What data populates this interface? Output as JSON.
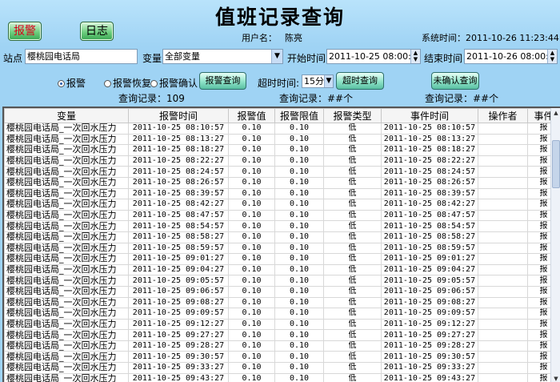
{
  "app": {
    "title": "值班记录查询",
    "user_label": "用户名：",
    "user_name": "陈亮",
    "system_time_label": "系统时间：",
    "system_time": "2011-10-26 11:23:44"
  },
  "nav": {
    "alarm_button": "报警",
    "log_button": "日志"
  },
  "filters": {
    "station_label": "站点",
    "station_value": "樱桃园电话局",
    "variable_label": "变量",
    "variable_value": "全部变量",
    "start_label": "开始时间",
    "start_value": "2011-10-25 08:00:00",
    "end_label": "结束时间",
    "end_value": "2011-10-26 08:00:00"
  },
  "query": {
    "radio_alarm": "报警",
    "radio_recover": "报警恢复",
    "radio_confirm": "报警确认",
    "alarm_query_button": "报警查询",
    "timeout_label": "超时时间:",
    "timeout_value": "15分",
    "timeout_query_button": "超时查询",
    "unconfirmed_query_button": "未确认查询",
    "record_label_1": "查询记录：109",
    "record_label_2": "查询记录：##个",
    "record_label_3": "查询记录：##个"
  },
  "table": {
    "columns": [
      "变量",
      "报警时间",
      "报警值",
      "报警限值",
      "报警类型",
      "事件时间",
      "操作者",
      "事件"
    ],
    "rows": [
      [
        "樱桃园电话局_一次回水压力",
        "2011-10-25 08:10:57",
        "0.10",
        "0.10",
        "低",
        "2011-10-25 08:10:57",
        "",
        "报"
      ],
      [
        "樱桃园电话局_一次回水压力",
        "2011-10-25 08:13:27",
        "0.10",
        "0.10",
        "低",
        "2011-10-25 08:13:27",
        "",
        "报"
      ],
      [
        "樱桃园电话局_一次回水压力",
        "2011-10-25 08:18:27",
        "0.10",
        "0.10",
        "低",
        "2011-10-25 08:18:27",
        "",
        "报"
      ],
      [
        "樱桃园电话局_一次回水压力",
        "2011-10-25 08:22:27",
        "0.10",
        "0.10",
        "低",
        "2011-10-25 08:22:27",
        "",
        "报"
      ],
      [
        "樱桃园电话局_一次回水压力",
        "2011-10-25 08:24:57",
        "0.10",
        "0.10",
        "低",
        "2011-10-25 08:24:57",
        "",
        "报"
      ],
      [
        "樱桃园电话局_一次回水压力",
        "2011-10-25 08:26:57",
        "0.10",
        "0.10",
        "低",
        "2011-10-25 08:26:57",
        "",
        "报"
      ],
      [
        "樱桃园电话局_一次回水压力",
        "2011-10-25 08:39:57",
        "0.10",
        "0.10",
        "低",
        "2011-10-25 08:39:57",
        "",
        "报"
      ],
      [
        "樱桃园电话局_一次回水压力",
        "2011-10-25 08:42:27",
        "0.10",
        "0.10",
        "低",
        "2011-10-25 08:42:27",
        "",
        "报"
      ],
      [
        "樱桃园电话局_一次回水压力",
        "2011-10-25 08:47:57",
        "0.10",
        "0.10",
        "低",
        "2011-10-25 08:47:57",
        "",
        "报"
      ],
      [
        "樱桃园电话局_一次回水压力",
        "2011-10-25 08:54:57",
        "0.10",
        "0.10",
        "低",
        "2011-10-25 08:54:57",
        "",
        "报"
      ],
      [
        "樱桃园电话局_一次回水压力",
        "2011-10-25 08:58:27",
        "0.10",
        "0.10",
        "低",
        "2011-10-25 08:58:27",
        "",
        "报"
      ],
      [
        "樱桃园电话局_一次回水压力",
        "2011-10-25 08:59:57",
        "0.10",
        "0.10",
        "低",
        "2011-10-25 08:59:57",
        "",
        "报"
      ],
      [
        "樱桃园电话局_一次回水压力",
        "2011-10-25 09:01:27",
        "0.10",
        "0.10",
        "低",
        "2011-10-25 09:01:27",
        "",
        "报"
      ],
      [
        "樱桃园电话局_一次回水压力",
        "2011-10-25 09:04:27",
        "0.10",
        "0.10",
        "低",
        "2011-10-25 09:04:27",
        "",
        "报"
      ],
      [
        "樱桃园电话局_一次回水压力",
        "2011-10-25 09:05:57",
        "0.10",
        "0.10",
        "低",
        "2011-10-25 09:05:57",
        "",
        "报"
      ],
      [
        "樱桃园电话局_一次回水压力",
        "2011-10-25 09:06:57",
        "0.10",
        "0.10",
        "低",
        "2011-10-25 09:06:57",
        "",
        "报"
      ],
      [
        "樱桃园电话局_一次回水压力",
        "2011-10-25 09:08:27",
        "0.10",
        "0.10",
        "低",
        "2011-10-25 09:08:27",
        "",
        "报"
      ],
      [
        "樱桃园电话局_一次回水压力",
        "2011-10-25 09:09:57",
        "0.10",
        "0.10",
        "低",
        "2011-10-25 09:09:57",
        "",
        "报"
      ],
      [
        "樱桃园电话局_一次回水压力",
        "2011-10-25 09:12:27",
        "0.10",
        "0.10",
        "低",
        "2011-10-25 09:12:27",
        "",
        "报"
      ],
      [
        "樱桃园电话局_一次回水压力",
        "2011-10-25 09:27:27",
        "0.10",
        "0.10",
        "低",
        "2011-10-25 09:27:27",
        "",
        "报"
      ],
      [
        "樱桃园电话局_一次回水压力",
        "2011-10-25 09:28:27",
        "0.10",
        "0.10",
        "低",
        "2011-10-25 09:28:27",
        "",
        "报"
      ],
      [
        "樱桃园电话局_一次回水压力",
        "2011-10-25 09:30:57",
        "0.10",
        "0.10",
        "低",
        "2011-10-25 09:30:57",
        "",
        "报"
      ],
      [
        "樱桃园电话局_一次回水压力",
        "2011-10-25 09:33:27",
        "0.10",
        "0.10",
        "低",
        "2011-10-25 09:33:27",
        "",
        "报"
      ],
      [
        "樱桃园电话局_一次回水压力",
        "2011-10-25 09:43:27",
        "0.10",
        "0.10",
        "低",
        "2011-10-25 09:43:27",
        "",
        "报"
      ]
    ]
  }
}
